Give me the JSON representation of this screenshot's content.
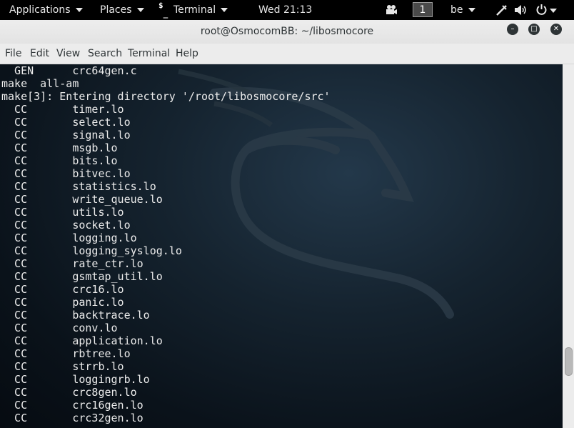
{
  "topbar": {
    "applications": "Applications",
    "places": "Places",
    "terminal_app": "Terminal",
    "clock": "Wed 21:13",
    "workspace": "1",
    "keyboard_layout": "be"
  },
  "window": {
    "title": "root@OsmocomBB: ~/libosmocore"
  },
  "menu": {
    "file": "File",
    "edit": "Edit",
    "view": "View",
    "search": "Search",
    "terminal": "Terminal",
    "help": "Help"
  },
  "terminal": {
    "lines": [
      "  GEN      crc64gen.c",
      "make  all-am",
      "make[3]: Entering directory '/root/libosmocore/src'",
      "  CC       timer.lo",
      "  CC       select.lo",
      "  CC       signal.lo",
      "  CC       msgb.lo",
      "  CC       bits.lo",
      "  CC       bitvec.lo",
      "  CC       statistics.lo",
      "  CC       write_queue.lo",
      "  CC       utils.lo",
      "  CC       socket.lo",
      "  CC       logging.lo",
      "  CC       logging_syslog.lo",
      "  CC       rate_ctr.lo",
      "  CC       gsmtap_util.lo",
      "  CC       crc16.lo",
      "  CC       panic.lo",
      "  CC       backtrace.lo",
      "  CC       conv.lo",
      "  CC       application.lo",
      "  CC       rbtree.lo",
      "  CC       strrb.lo",
      "  CC       loggingrb.lo",
      "  CC       crc8gen.lo",
      "  CC       crc16gen.lo",
      "  CC       crc32gen.lo"
    ]
  },
  "icons": {
    "terminal_app": "terminal-prompt-icon",
    "video": "camera-icon",
    "accessibility": "pen-icon",
    "volume": "speaker-icon",
    "power": "power-icon"
  }
}
